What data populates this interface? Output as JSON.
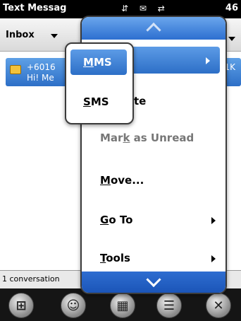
{
  "titlebar": {
    "title": "Text Messag",
    "status_icons": "⇵ ✉ ⇄",
    "time": "46"
  },
  "inbox": {
    "label": "Inbox"
  },
  "message": {
    "sender": "+6016",
    "preview": "Hi! Me",
    "size": "1K"
  },
  "status": {
    "conversation_count": "1 conversation"
  },
  "menu": {
    "items": [
      {
        "label": "",
        "has_submenu": true,
        "highlighted": true
      },
      {
        "label": "te",
        "has_submenu": false
      },
      {
        "label": "Mark as Unread",
        "pre": "Mar",
        "accel": "k",
        "post": " as Unread",
        "disabled": true
      },
      {
        "label": "Move...",
        "accel": "M",
        "post": "ove..."
      },
      {
        "label": "Go To",
        "accel": "G",
        "post": "o To",
        "has_submenu": true
      },
      {
        "label": "Tools",
        "accel": "T",
        "post": "ools",
        "has_submenu": true
      }
    ]
  },
  "submenu": {
    "items": [
      {
        "label": "MMS",
        "accel": "M",
        "post": "MS",
        "highlighted": true
      },
      {
        "label": "SMS",
        "accel": "S",
        "post": "MS"
      }
    ]
  },
  "softkeys": [
    "windows-icon",
    "contact-icon",
    "keyboard-icon",
    "menu-icon",
    "close-icon"
  ],
  "colors": {
    "accent": "#2d6fc7",
    "title_bg": "#000000",
    "softkey_bar": "#151515"
  }
}
